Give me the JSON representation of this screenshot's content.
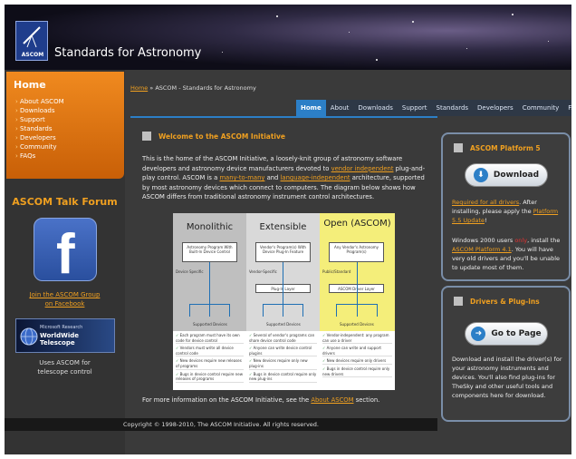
{
  "header": {
    "logo_text": "ASCOM",
    "site_title": "Standards for Astronomy"
  },
  "sidebar": {
    "home_title": "Home",
    "links": [
      "About ASCOM",
      "Downloads",
      "Support",
      "Standards",
      "Developers",
      "Community",
      "FAQs"
    ],
    "talk_forum_title": "ASCOM Talk Forum",
    "facebook_icon_letter": "f",
    "facebook_link_line1": "Join the ASCOM Group",
    "facebook_link_line2": "on Facebook",
    "wwt_small": "Microsoft Research",
    "wwt_name": "WorldWide Telescope",
    "wwt_caption_line1": "Uses ASCOM for",
    "wwt_caption_line2": "telescope control"
  },
  "breadcrumb": {
    "home": "Home",
    "separator": " » ",
    "current": "ASCOM - Standards for Astronomy"
  },
  "nav": {
    "items": [
      "Home",
      "About",
      "Downloads",
      "Support",
      "Standards",
      "Developers",
      "Community",
      "FAQs"
    ]
  },
  "main": {
    "welcome_title": "Welcome to the ASCOM Initiative",
    "intro_1": "This is the home of the ASCOM Initiative, a loosely-knit group of astronomy software developers and astronomy device manufacturers devoted to ",
    "intro_link_1": "vendor independent",
    "intro_2": " plug-and-play control. ASCOM is a ",
    "intro_link_2": "many-to-many",
    "intro_3": " and ",
    "intro_link_3": "language-independent",
    "intro_4": " architecture, supported by most astronomy devices which connect to computers. The diagram below shows how ASCOM differs from traditional astronomy instrument control architectures.",
    "more_info_text": "For more information on the ASCOM Initiative, see the ",
    "more_info_link": "About ASCOM",
    "more_info_end": " section."
  },
  "diagram": {
    "columns": [
      {
        "title": "Monolithic",
        "bg": "#bfbfbf",
        "box": "Astronomy Program With Built-In Device Control",
        "label": "Device Specific",
        "bottom": "Supported Devices",
        "bullets": [
          "Each program must have its own code for device control",
          "Vendors must write all device control code",
          "New devices require new releases of programs",
          "Bugs in device control require new releases of programs"
        ]
      },
      {
        "title": "Extensible",
        "bg": "#d9d9d9",
        "box": "Vendor's Program(s) With Device Plug-In Feature",
        "label": "Vendor-Specific",
        "plug": "Plug-In Layer",
        "bottom": "Supported Devices",
        "bullets": [
          "Several of vendor's programs can share device control code",
          "Anyone can write device control plugins",
          "New devices require only new plug-ins",
          "Bugs in device control require only new plug-ins"
        ]
      },
      {
        "title": "Open (ASCOM)",
        "bg": "#f4ee7a",
        "box": "Any Vendor's Astronomy Program(s)",
        "label": "Public/Standard",
        "plug": "ASCOM Driver Layer",
        "bottom": "Supported Devices",
        "bullets": [
          "Vendor-independent: any program can use a driver",
          "Anyone can write and support drivers",
          "New devices require only drivers",
          "Bugs in device control require only new drivers"
        ]
      }
    ]
  },
  "footer": {
    "copyright": "Copyright © 1998-2010, The ASCOM Initiative. All rights reserved."
  },
  "platform_panel": {
    "title": "ASCOM Platform 5",
    "button_label": "Download",
    "text_link": "Required for all drivers",
    "text_1": ". After installing, please apply the ",
    "update_link": "Platform 5.5 Update",
    "text_2": "!",
    "win_text_1": "Windows 2000 users ",
    "win_highlight": "only",
    "win_text_2": ", install the ",
    "platform41_link": "ASCOM Platform 4.1",
    "win_text_3": ". You will have very old drivers and you'll be unable to update most of them."
  },
  "drivers_panel": {
    "title": "Drivers & Plug-ins",
    "button_label": "Go to Page",
    "text": "Download and install the driver(s) for your astronomy instruments and devices. You'll also find plug-ins for TheSky and other useful tools and components here for download."
  },
  "colors": {
    "accent_orange": "#f0a020",
    "nav_active": "#2c7fc7",
    "panel_border": "#7a8ea8"
  }
}
